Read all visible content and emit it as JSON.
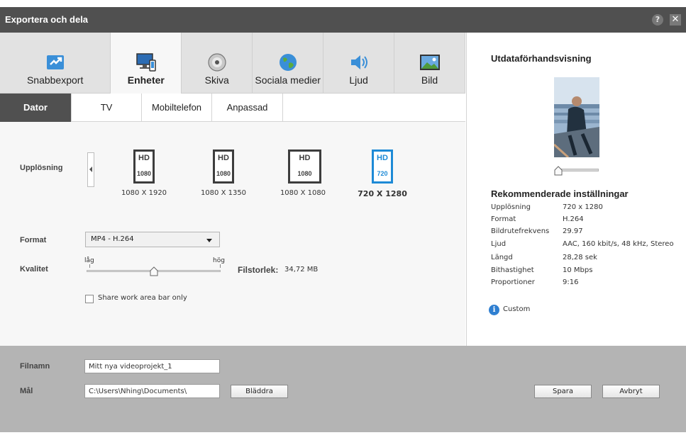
{
  "window": {
    "title": "Exportera och dela",
    "help_icon": "?",
    "close_icon": "✕"
  },
  "category_tabs": [
    {
      "label": "Snabbexport",
      "icon": "quick-export-icon"
    },
    {
      "label": "Enheter",
      "icon": "devices-icon",
      "active": true
    },
    {
      "label": "Skiva",
      "icon": "disc-icon"
    },
    {
      "label": "Sociala medier",
      "icon": "globe-icon"
    },
    {
      "label": "Ljud",
      "icon": "speaker-icon"
    },
    {
      "label": "Bild",
      "icon": "picture-icon"
    }
  ],
  "sub_tabs": [
    {
      "label": "Dator",
      "active": true
    },
    {
      "label": "TV"
    },
    {
      "label": "Mobiltelefon"
    },
    {
      "label": "Anpassad"
    }
  ],
  "resolution": {
    "label": "Upplösning",
    "presets": [
      {
        "badge": "HD",
        "number": "1080",
        "label": "1080 X 1920"
      },
      {
        "badge": "HD",
        "number": "1080",
        "label": "1080 X 1350"
      },
      {
        "badge": "HD",
        "number": "1080",
        "label": "1080 X 1080"
      },
      {
        "badge": "HD",
        "number": "720",
        "label": "720 X 1280",
        "selected": true
      }
    ]
  },
  "format": {
    "label": "Format",
    "value": "MP4 - H.264"
  },
  "quality": {
    "label": "Kvalitet",
    "low": "låg",
    "high": "hög",
    "level": 0.5
  },
  "filesize": {
    "label": "Filstorlek:",
    "value": "34,72 MB"
  },
  "share_checkbox": {
    "label": "Share work area bar only",
    "checked": false
  },
  "preview": {
    "title": "Utdataförhandsvisning",
    "position": 0.0
  },
  "recommended": {
    "title": "Rekommenderade inställningar",
    "rows": [
      {
        "key": "Upplösning",
        "value": "720 x 1280"
      },
      {
        "key": "Format",
        "value": "H.264"
      },
      {
        "key": "Bildrutefrekvens",
        "value": "29.97"
      },
      {
        "key": "Ljud",
        "value": "AAC, 160 kbit/s, 48  kHz, Stereo"
      },
      {
        "key": "Längd",
        "value": "28,28 sek"
      },
      {
        "key": "Bithastighet",
        "value": "10 Mbps"
      },
      {
        "key": "Proportioner",
        "value": "9:16"
      }
    ],
    "custom_link": "Custom"
  },
  "bottom": {
    "filename_label": "Filnamn",
    "filename_value": "Mitt nya videoprojekt_1",
    "target_label": "Mål",
    "target_value": "C:\\Users\\Nhing\\Documents\\",
    "browse_button": "Bläddra",
    "save_button": "Spara",
    "cancel_button": "Avbryt"
  },
  "colors": {
    "titlebar": "#505050",
    "accent": "#1e8ad6",
    "bottom_bar": "#b4b4b4"
  }
}
